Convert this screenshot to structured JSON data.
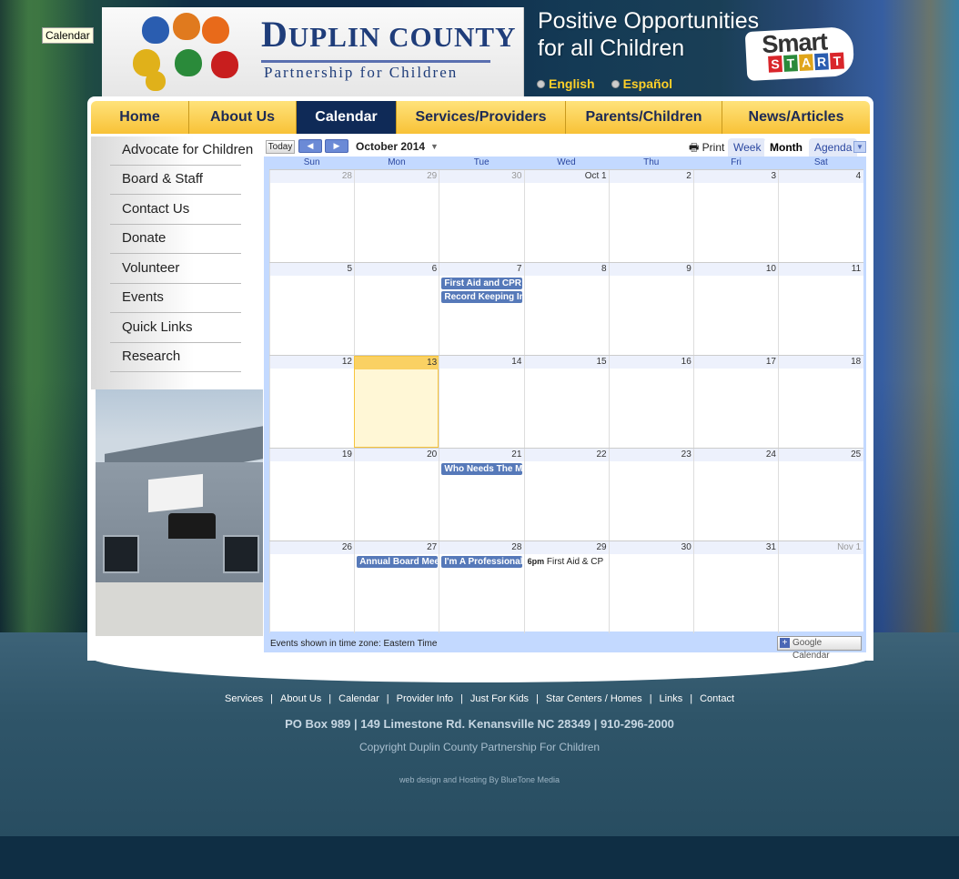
{
  "tooltip": "Calendar",
  "header": {
    "logo_title_first": "D",
    "logo_title_rest": "UPLIN COUNTY",
    "logo_subtitle": "Partnership for Children",
    "tagline_line1": "Positive Opportunities",
    "tagline_line2": "for all Children",
    "languages": [
      "English",
      "Español"
    ],
    "smart_start_word1": "Smart",
    "smart_start_word2": [
      "S",
      "T",
      "A",
      "R",
      "T"
    ]
  },
  "nav": {
    "items": [
      "Home",
      "About Us",
      "Calendar",
      "Services/Providers",
      "Parents/Children",
      "News/Articles"
    ],
    "active": "Calendar"
  },
  "sidebar": {
    "items": [
      "Advocate for Children",
      "Board & Staff",
      "Contact Us",
      "Donate",
      "Volunteer",
      "Events",
      "Quick Links",
      "Research"
    ]
  },
  "calendar": {
    "today_label": "Today",
    "prev_icon": "◀",
    "next_icon": "▶",
    "month_label": "October 2014",
    "print_label": "Print",
    "views": [
      "Week",
      "Month",
      "Agenda"
    ],
    "active_view": "Month",
    "weekdays": [
      "Sun",
      "Mon",
      "Tue",
      "Wed",
      "Thu",
      "Fri",
      "Sat"
    ],
    "weeks": [
      [
        {
          "d": "28",
          "other": true
        },
        {
          "d": "29",
          "other": true
        },
        {
          "d": "30",
          "other": true
        },
        {
          "d": "Oct 1"
        },
        {
          "d": "2"
        },
        {
          "d": "3"
        },
        {
          "d": "4"
        }
      ],
      [
        {
          "d": "5"
        },
        {
          "d": "6"
        },
        {
          "d": "7"
        },
        {
          "d": "8"
        },
        {
          "d": "9"
        },
        {
          "d": "10"
        },
        {
          "d": "11"
        }
      ],
      [
        {
          "d": "12"
        },
        {
          "d": "13",
          "today": true
        },
        {
          "d": "14"
        },
        {
          "d": "15"
        },
        {
          "d": "16"
        },
        {
          "d": "17"
        },
        {
          "d": "18"
        }
      ],
      [
        {
          "d": "19"
        },
        {
          "d": "20"
        },
        {
          "d": "21"
        },
        {
          "d": "22"
        },
        {
          "d": "23"
        },
        {
          "d": "24"
        },
        {
          "d": "25"
        }
      ],
      [
        {
          "d": "26"
        },
        {
          "d": "27"
        },
        {
          "d": "28"
        },
        {
          "d": "29"
        },
        {
          "d": "30"
        },
        {
          "d": "31"
        },
        {
          "d": "Nov 1",
          "other": true
        }
      ]
    ],
    "events": [
      {
        "week": 1,
        "day": 2,
        "slot": 0,
        "title": "First Aid and CPR"
      },
      {
        "week": 1,
        "day": 2,
        "slot": 1,
        "title": "Record Keeping In"
      },
      {
        "week": 3,
        "day": 2,
        "slot": 0,
        "title": "Who Needs The M"
      },
      {
        "week": 4,
        "day": 1,
        "slot": 0,
        "title": "Annual Board Mee"
      },
      {
        "week": 4,
        "day": 2,
        "slot": 0,
        "title": "I'm A Professional"
      },
      {
        "week": 4,
        "day": 3,
        "slot": 0,
        "time": "6pm",
        "title": "First Aid & CP",
        "plain": true
      }
    ],
    "timezone_note": "Events shown in time zone: Eastern Time",
    "gcal_label": "Google Calendar"
  },
  "footer": {
    "links": [
      "Services",
      "About Us",
      "Calendar",
      "Provider Info",
      "Just For Kids",
      "Star Centers / Homes",
      "Links",
      "Contact"
    ],
    "address": "PO Box 989 | 149 Limestone Rd. Kenansville NC 28349 | 910-296-2000",
    "copyright": "Copyright Duplin County Partnership For Children",
    "credit": "web design and Hosting By BlueTone Media"
  },
  "colors": {
    "nav_gold": "#f8c237",
    "nav_active": "#0f2a57",
    "event_blue": "#5679b9",
    "today_yellow": "#fff7d6"
  }
}
